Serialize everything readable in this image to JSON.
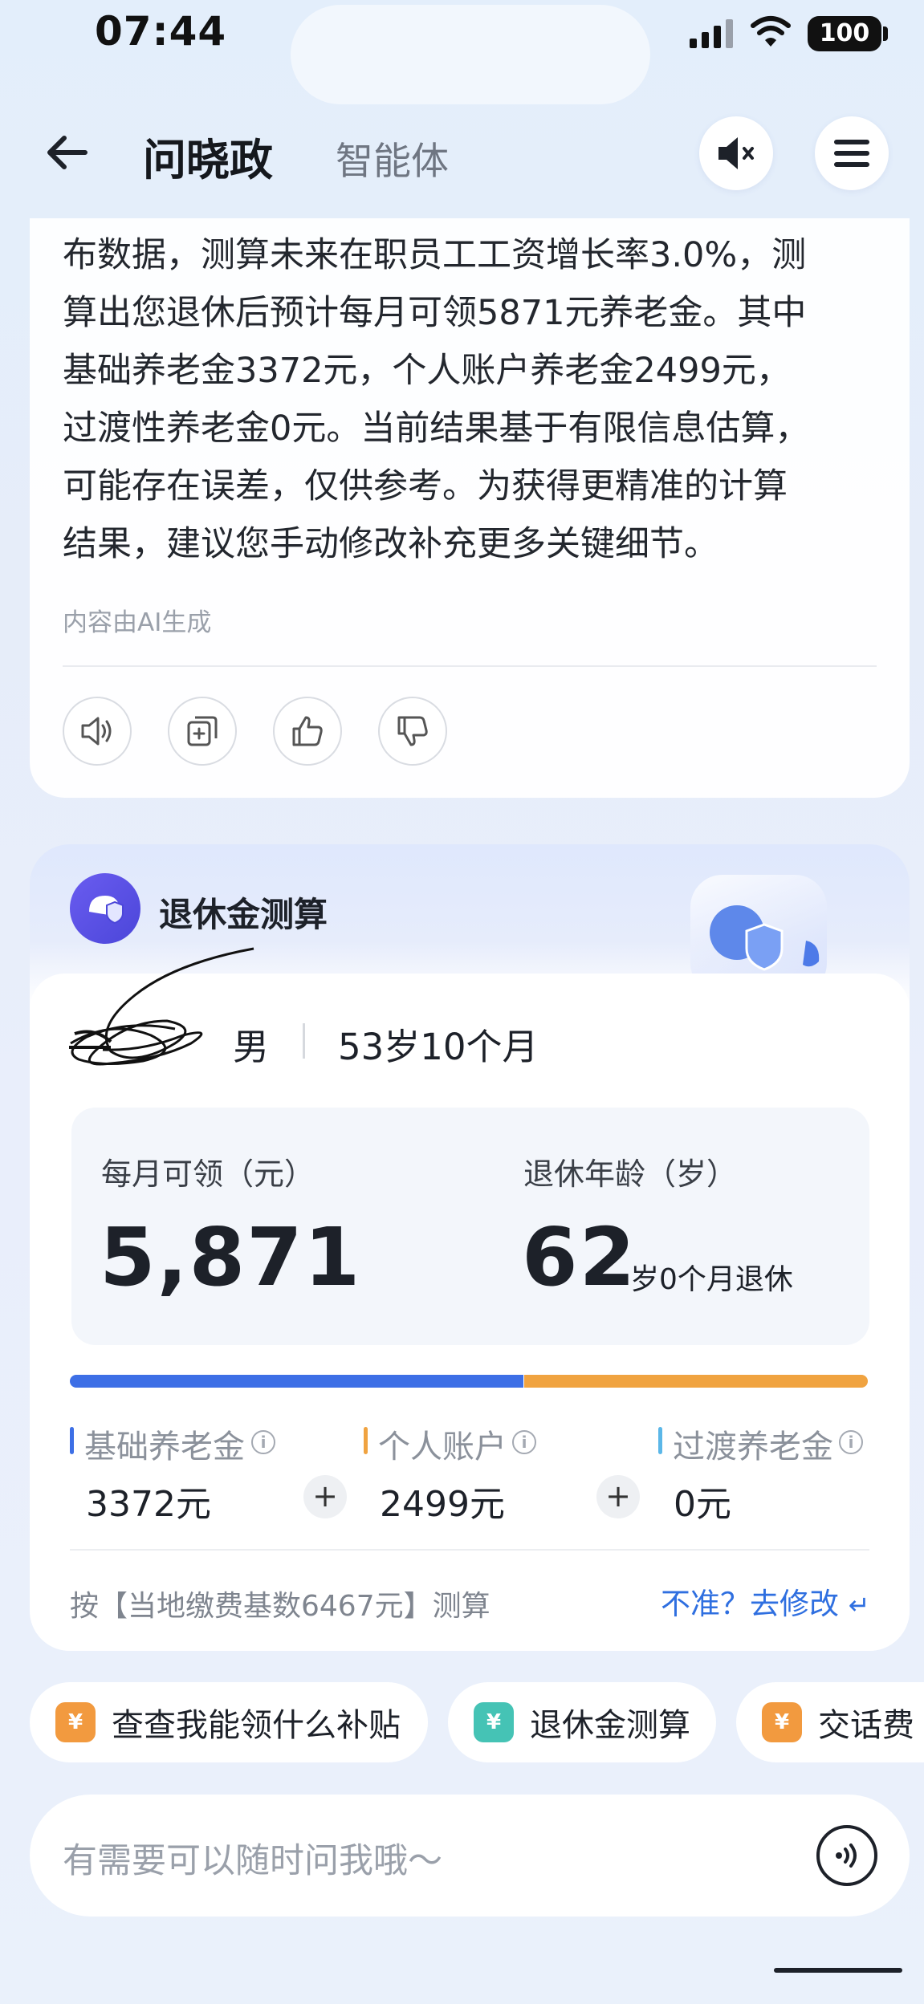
{
  "status_bar": {
    "time": "07:44",
    "battery": "100"
  },
  "header": {
    "title": "问晓政",
    "subtitle": "智能体"
  },
  "message": {
    "lines": [
      "布数据，测算未来在职员工工资增长率3.0%，测",
      "算出您退休后预计每月可领5871元养老金。其中",
      "基础养老金3372元，个人账户养老金2499元，",
      "过渡性养老金0元。当前结果基于有限信息估算，",
      "可能存在误差，仅供参考。为获得更精准的计算",
      "结果，建议您手动修改补充更多关键细节。"
    ],
    "ai_note": "内容由AI生成"
  },
  "calculator": {
    "title": "退休金测算",
    "gender": "男",
    "age": "53岁10个月",
    "monthly_label": "每月可领（元）",
    "monthly_value": "5,871",
    "retire_label": "退休年龄（岁）",
    "retire_value": "62",
    "retire_unit": "岁0个月退休",
    "bar_split": {
      "basic": 3372,
      "personal": 2499,
      "transition": 0
    },
    "parts": [
      {
        "label": "基础养老金",
        "value": "3372元",
        "color": "#3d6fe6"
      },
      {
        "label": "个人账户",
        "value": "2499元",
        "color": "#f0a340"
      },
      {
        "label": "过渡养老金",
        "value": "0元",
        "color": "#5bb7e8"
      }
    ],
    "plus": "+",
    "basis": "按【当地缴费基数6467元】测算",
    "edit_link": "不准？去修改"
  },
  "chips": [
    {
      "label": "查查我能领什么补贴",
      "icon": "subsidy-icon",
      "icon_text": "¥",
      "color": "#f29a3f"
    },
    {
      "label": "退休金测算",
      "icon": "pension-icon",
      "icon_text": "¥",
      "color": "#45c3b5"
    },
    {
      "label": "交话费",
      "icon": "phone-bill-icon",
      "icon_text": "¥",
      "color": "#f29a3f"
    }
  ],
  "input": {
    "placeholder": "有需要可以随时问我哦～"
  }
}
